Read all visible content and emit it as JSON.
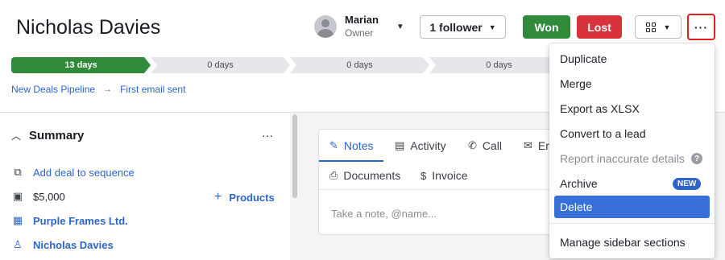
{
  "deal": {
    "title": "Nicholas Davies"
  },
  "owner": {
    "name": "Marian",
    "role": "Owner",
    "avatar_icon": "person-avatar-icon"
  },
  "header_actions": {
    "follower_label": "1 follower",
    "won_label": "Won",
    "lost_label": "Lost",
    "more_label": "···",
    "won_color": "#308a3a",
    "lost_color": "#d8333b"
  },
  "pipeline": {
    "stages": [
      {
        "label": "13 days",
        "active": true
      },
      {
        "label": "0 days",
        "active": false
      },
      {
        "label": "0 days",
        "active": false
      },
      {
        "label": "0 days",
        "active": false
      }
    ],
    "breadcrumb": {
      "pipeline": "New Deals Pipeline",
      "stage": "First email sent"
    }
  },
  "summary": {
    "title": "Summary",
    "more_label": "···",
    "add_sequence": "Add deal to sequence",
    "value": "$5,000",
    "products_label": "Products",
    "organization": "Purple Frames Ltd.",
    "person": "Nicholas Davies"
  },
  "notes_panel": {
    "tabs": [
      "Notes",
      "Activity",
      "Call",
      "Em",
      "Documents",
      "Invoice"
    ],
    "placeholder": "Take a note, @name..."
  },
  "more_menu": {
    "items": [
      "Duplicate",
      "Merge",
      "Export as XLSX",
      "Convert to a lead",
      "Report inaccurate details",
      "Archive",
      "Delete",
      "Manage sidebar sections"
    ],
    "archive_badge": "NEW",
    "help_glyph": "?"
  }
}
